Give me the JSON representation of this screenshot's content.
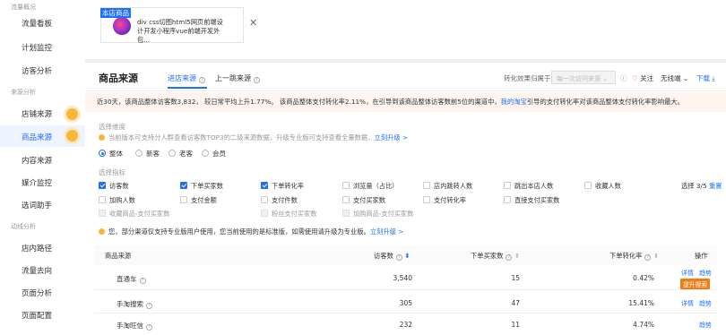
{
  "sidebar": {
    "groups": [
      "流量概况",
      "来源分析",
      "动线分析"
    ],
    "items": [
      {
        "label": "流量看板"
      },
      {
        "label": "计划监控"
      },
      {
        "label": "访客分析"
      },
      {
        "label": "店铺来源"
      },
      {
        "label": "商品来源"
      },
      {
        "label": "内容来源"
      },
      {
        "label": "媒介监控"
      },
      {
        "label": "选词助手"
      },
      {
        "label": "店内路径"
      },
      {
        "label": "流量去向"
      },
      {
        "label": "页面分析"
      },
      {
        "label": "页面配置"
      }
    ]
  },
  "top": {
    "highlight": "本店商品",
    "product_title": "div css切图html5网页前端设计开发小程序vue前端开发外包...",
    "close": "✕"
  },
  "header": {
    "title": "商品来源",
    "tabs": [
      "进店来源",
      "上一跳来源"
    ],
    "effect_label": "转化效果归属于：",
    "effect_select": "每一次访问来源",
    "follow": "关注",
    "no_warning": "无线端",
    "download": "下载"
  },
  "notice": {
    "text": "近30天，该商品整体访客数3,832， 较日常平均上升1.77%。 该商品整体支付转化率2.11%，在引导到该商品整体访客数前5位的渠道中，",
    "link": "我的淘宝",
    "text2": "引导的支付转化率对该商品整体支付转化率影响最大。"
  },
  "filter": {
    "dimension_label": "选择维度",
    "dimension_tip": "当前版本可支持分人群查看访客数TOP3的二级来源数据，升级专业版可支持查看全量数据，",
    "upgrade_link": "立刻升级 >",
    "radios": [
      "整体",
      "新客",
      "老客",
      "会员"
    ],
    "metric_label": "选择指标",
    "metrics_row1": [
      {
        "label": "访客数",
        "checked": true
      },
      {
        "label": "下单买家数",
        "checked": true
      },
      {
        "label": "下单转化率",
        "checked": true
      },
      {
        "label": "浏览量（占比）",
        "checked": false
      },
      {
        "label": "店内跳转人数",
        "checked": false
      },
      {
        "label": "跳出本店人数",
        "checked": false
      },
      {
        "label": "收藏人数",
        "checked": false
      }
    ],
    "metrics_row2": [
      {
        "label": "加购人数"
      },
      {
        "label": "支付金额"
      },
      {
        "label": "支付件数"
      },
      {
        "label": "支付买家数"
      },
      {
        "label": "支付转化率"
      },
      {
        "label": "直接支付买家数"
      }
    ],
    "metrics_row3": [
      {
        "label": "收藏商品-支付买家数"
      },
      {
        "label": "粉丝支付买家数"
      },
      {
        "label": "加购商品-支付买家数"
      }
    ],
    "selected_count": "选择 3/5",
    "reset": "重置",
    "version_tip": "您，部分渠道仅支持专业版用户使用，您当前使用的是标准版，如需使用请升级为专业版。",
    "version_link": "立刻升级 >"
  },
  "table": {
    "headers": {
      "source": "商品来源",
      "visitors": "访客数",
      "buyers": "下单买家数",
      "rate": "下单转化率",
      "action": "操作"
    },
    "rows": [
      {
        "name": "直通车",
        "visitors": "3,540",
        "buyers": "15",
        "rate": "0.42%",
        "detail": "详情",
        "trend": "趋势",
        "badge": "提升搜索"
      },
      {
        "name": "手淘搜索",
        "visitors": "305",
        "buyers": "47",
        "rate": "15.41%",
        "detail": "详情",
        "trend": "趋势"
      },
      {
        "name": "手淘旺信",
        "visitors": "232",
        "buyers": "11",
        "rate": "4.74%",
        "trend": "趋势"
      }
    ]
  },
  "colors": {
    "accent": "#1e6fff",
    "warning": "#f6b73c",
    "badge": "#f27c14",
    "notice_bg": "#fff4ee"
  }
}
